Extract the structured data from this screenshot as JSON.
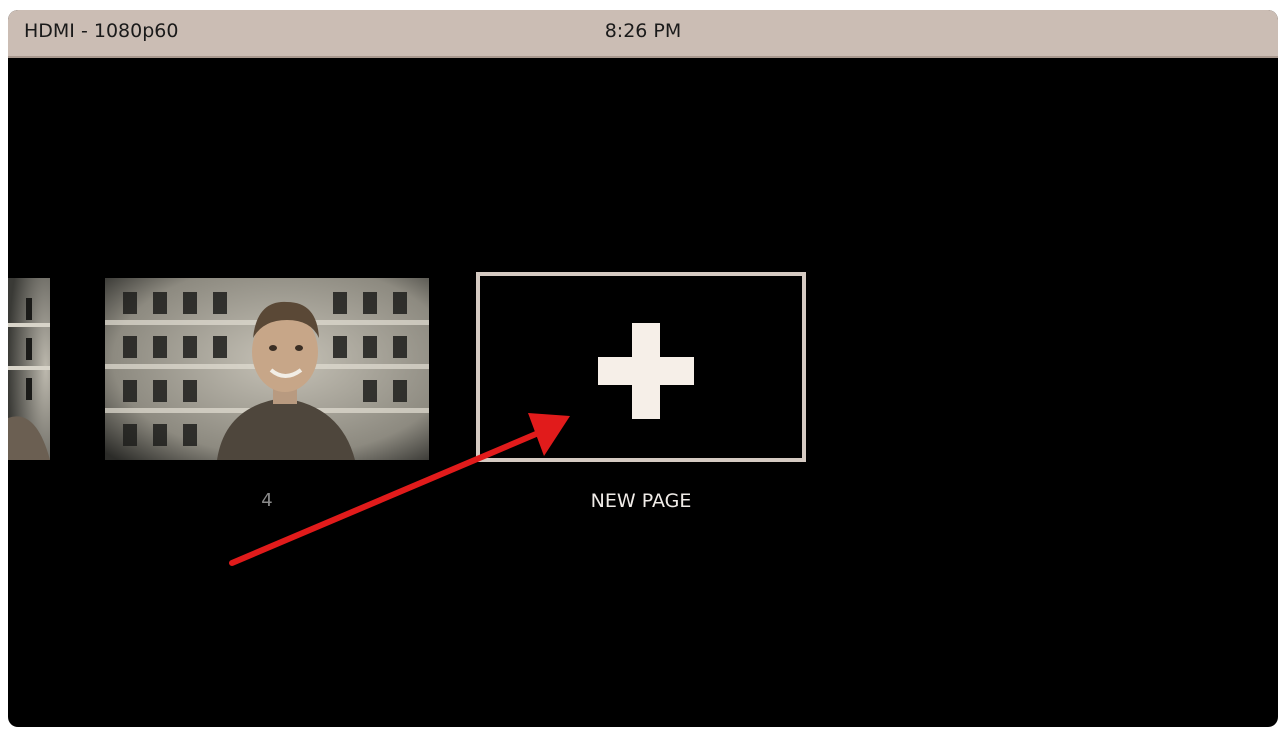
{
  "status_bar": {
    "input_label": "HDMI - 1080p60",
    "time": "8:26 PM"
  },
  "pages": [
    {
      "label": "4"
    }
  ],
  "new_page": {
    "label": "NEW PAGE",
    "icon": "plus-icon"
  },
  "annotation": {
    "icon": "red-arrow-icon",
    "color": "#e11b1b"
  },
  "colors": {
    "status_bar_bg": "#cbbdb4",
    "background": "#000000",
    "box_border": "#d5cac2"
  }
}
